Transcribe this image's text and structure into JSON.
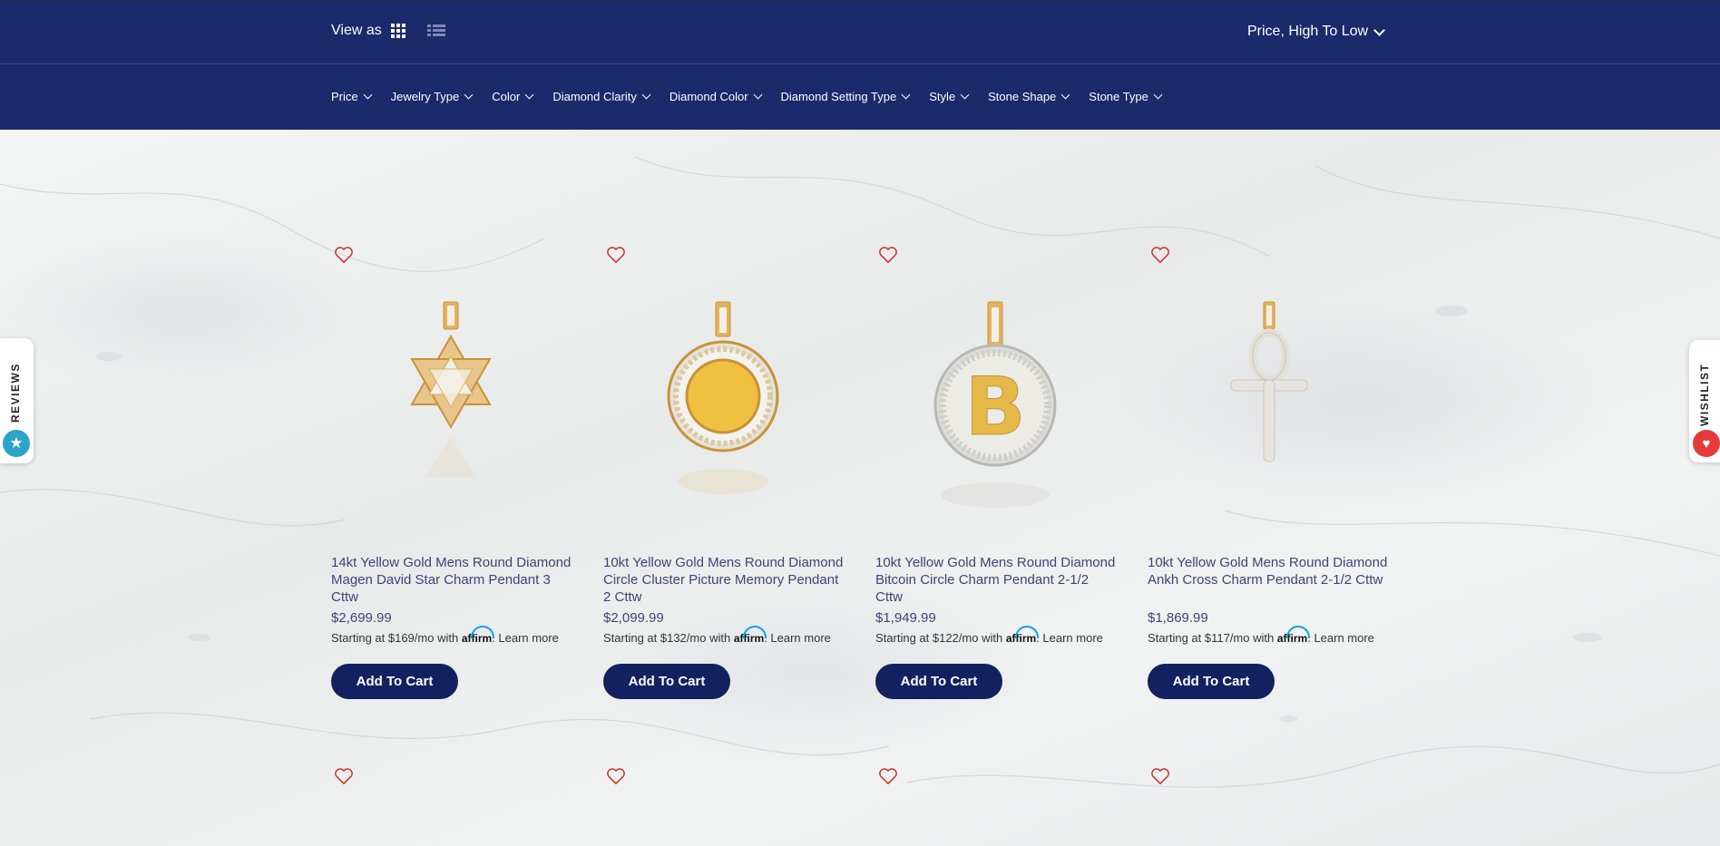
{
  "toolbar": {
    "view_as_label": "View as",
    "sort_label": "Price, High To Low"
  },
  "filters": [
    "Price",
    "Jewelry Type",
    "Color",
    "Diamond Clarity",
    "Diamond Color",
    "Diamond Setting Type",
    "Style",
    "Stone Shape",
    "Stone Type"
  ],
  "side_tabs": {
    "reviews_label": "REVIEWS",
    "wishlist_label": "WISHLIST"
  },
  "products": [
    {
      "name": "14kt Yellow Gold Mens Round Diamond Magen David Star Charm Pendant 3 Cttw",
      "price": "$2,699.99",
      "affirm_prefix": "Starting at $169/mo with",
      "icon": "star-of-david-pendant"
    },
    {
      "name": "10kt Yellow Gold Mens Round Diamond Circle Cluster Picture Memory Pendant 2 Cttw",
      "price": "$2,099.99",
      "affirm_prefix": "Starting at $132/mo with",
      "icon": "picture-memory-pendant"
    },
    {
      "name": "10kt Yellow Gold Mens Round Diamond Bitcoin Circle Charm Pendant 2-1/2 Cttw",
      "price": "$1,949.99",
      "affirm_prefix": "Starting at $122/mo with",
      "icon": "bitcoin-pendant"
    },
    {
      "name": "10kt Yellow Gold Mens Round Diamond Ankh Cross Charm Pendant 2-1/2 Cttw",
      "price": "$1,869.99",
      "affirm_prefix": "Starting at $117/mo with",
      "icon": "ankh-cross-pendant"
    }
  ],
  "affirm_logo": "affirm",
  "learn_more": "Learn more",
  "add_to_cart": "Add To Cart",
  "colors": {
    "nav_bg": "#1b2a6b",
    "button_bg": "#12215f",
    "heart": "#c8302e",
    "reviews_badge": "#2aa4c8",
    "wishlist_badge": "#e63a3a"
  }
}
